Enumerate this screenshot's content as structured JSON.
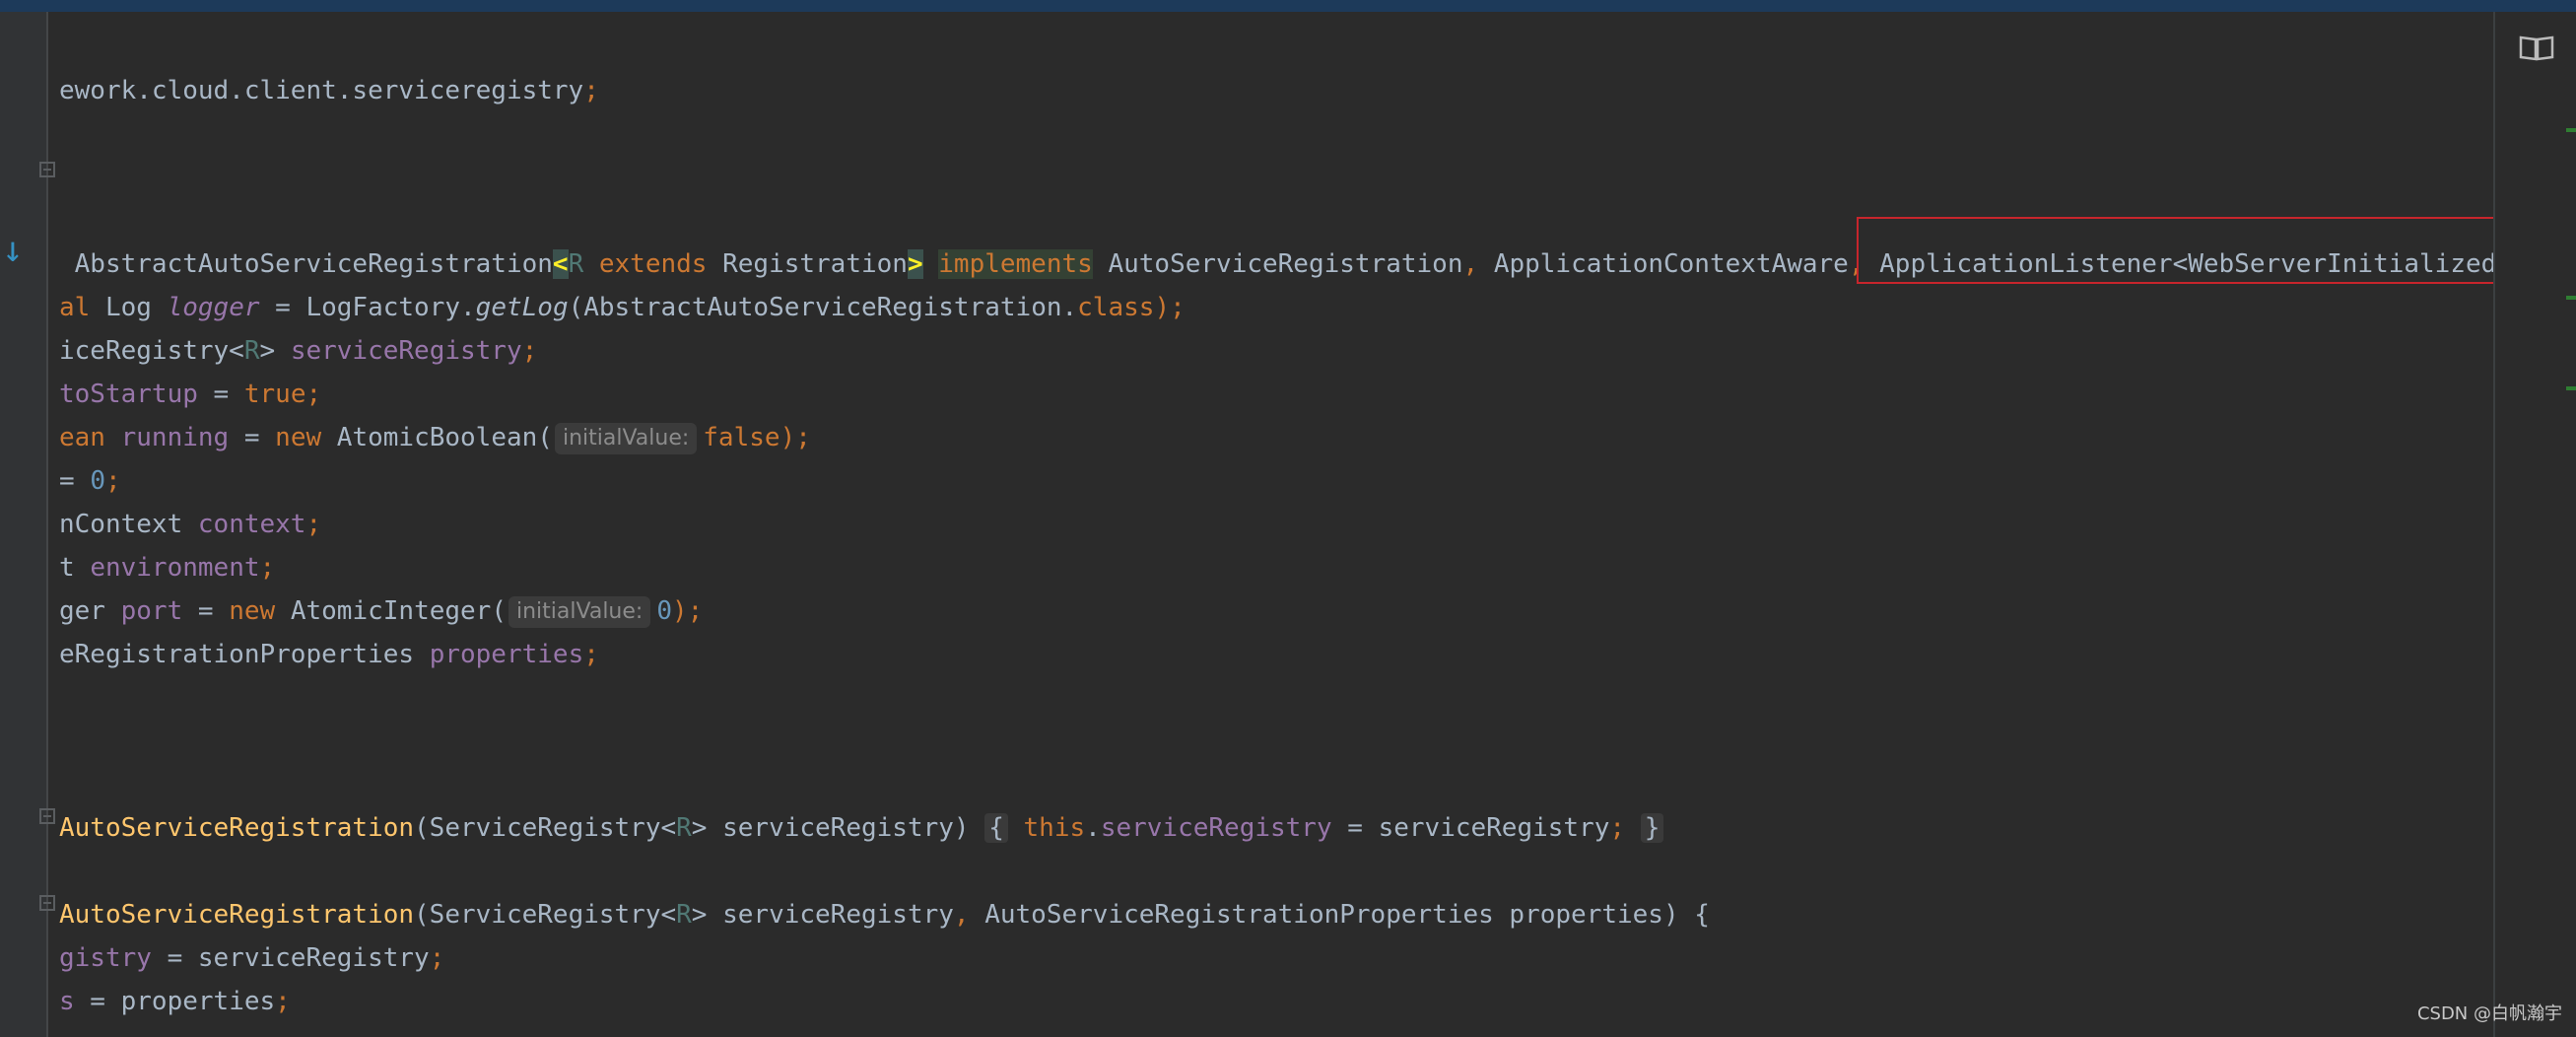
{
  "editor": {
    "lines": [
      {
        "id": "l1",
        "tokens": [
          {
            "t": "ework.cloud.client.serviceregistry",
            "c": ""
          },
          {
            "t": ";",
            "c": "kw"
          }
        ]
      },
      {
        "id": "l2",
        "tokens": [
          {
            "t": " AbstractAutoServiceRegistration",
            "c": ""
          },
          {
            "t": "<",
            "c": "bracket-hl"
          },
          {
            "t": "R",
            "c": "tp"
          },
          {
            "t": " extends ",
            "c": "kw"
          },
          {
            "t": "Registration",
            "c": ""
          },
          {
            "t": ">",
            "c": "bracket-hl"
          },
          {
            "t": " ",
            "c": ""
          },
          {
            "t": "implements",
            "c": "kw kw-hl"
          },
          {
            "t": " AutoServiceRegistration",
            "c": ""
          },
          {
            "t": ", ",
            "c": "kw"
          },
          {
            "t": "ApplicationContextAware",
            "c": ""
          },
          {
            "t": ", ",
            "c": "kw"
          },
          {
            "t": "ApplicationListener<WebServerInitializedEvent>",
            "c": ""
          }
        ]
      },
      {
        "id": "l3",
        "tokens": [
          {
            "t": "al ",
            "c": "kw"
          },
          {
            "t": "Log ",
            "c": ""
          },
          {
            "t": "logger",
            "c": "fld-i"
          },
          {
            "t": " = LogFactory.",
            "c": ""
          },
          {
            "t": "getLog",
            "c": "it"
          },
          {
            "t": "(AbstractAutoServiceRegistration.",
            "c": ""
          },
          {
            "t": "class",
            "c": "kw"
          },
          {
            "t": ");",
            "c": "kw"
          }
        ]
      },
      {
        "id": "l4",
        "tokens": [
          {
            "t": "iceRegistry<",
            "c": ""
          },
          {
            "t": "R",
            "c": "tp"
          },
          {
            "t": "> ",
            "c": ""
          },
          {
            "t": "serviceRegistry",
            "c": "fld"
          },
          {
            "t": ";",
            "c": "kw"
          }
        ]
      },
      {
        "id": "l5",
        "tokens": [
          {
            "t": "toStartup",
            "c": "fld"
          },
          {
            "t": " = ",
            "c": ""
          },
          {
            "t": "true;",
            "c": "kw"
          }
        ]
      },
      {
        "id": "l6",
        "tokens": [
          {
            "t": "ean ",
            "c": "kw"
          },
          {
            "t": "running",
            "c": "fld"
          },
          {
            "t": " = ",
            "c": ""
          },
          {
            "t": "new ",
            "c": "kw"
          },
          {
            "t": "AtomicBoolean(",
            "c": ""
          },
          {
            "t": "initialValue:",
            "c": "hint"
          },
          {
            "t": "false",
            "c": "kw"
          },
          {
            "t": ");",
            "c": "kw"
          }
        ]
      },
      {
        "id": "l7",
        "tokens": [
          {
            "t": "= ",
            "c": ""
          },
          {
            "t": "0",
            "c": "num"
          },
          {
            "t": ";",
            "c": "kw"
          }
        ]
      },
      {
        "id": "l8",
        "tokens": [
          {
            "t": "nContext ",
            "c": ""
          },
          {
            "t": "context",
            "c": "fld"
          },
          {
            "t": ";",
            "c": "kw"
          }
        ]
      },
      {
        "id": "l9",
        "tokens": [
          {
            "t": "t ",
            "c": ""
          },
          {
            "t": "environment",
            "c": "fld"
          },
          {
            "t": ";",
            "c": "kw"
          }
        ]
      },
      {
        "id": "l10",
        "tokens": [
          {
            "t": "ger ",
            "c": ""
          },
          {
            "t": "port",
            "c": "fld"
          },
          {
            "t": " = ",
            "c": ""
          },
          {
            "t": "new ",
            "c": "kw"
          },
          {
            "t": "AtomicInteger(",
            "c": ""
          },
          {
            "t": "initialValue:",
            "c": "hint"
          },
          {
            "t": "0",
            "c": "num"
          },
          {
            "t": ");",
            "c": "kw"
          }
        ]
      },
      {
        "id": "l11",
        "tokens": [
          {
            "t": "eRegistrationProperties ",
            "c": ""
          },
          {
            "t": "properties",
            "c": "fld"
          },
          {
            "t": ";",
            "c": "kw"
          }
        ]
      },
      {
        "id": "l12",
        "tokens": [
          {
            "t": "AutoServiceRegistration",
            "c": "fn"
          },
          {
            "t": "(ServiceRegistry<",
            "c": ""
          },
          {
            "t": "R",
            "c": "tp"
          },
          {
            "t": "> serviceRegistry) ",
            "c": ""
          },
          {
            "t": "{",
            "c": "brace-box"
          },
          {
            "t": " ",
            "c": ""
          },
          {
            "t": "this",
            "c": "kw"
          },
          {
            "t": ".",
            "c": ""
          },
          {
            "t": "serviceRegistry",
            "c": "fld"
          },
          {
            "t": " = serviceRegistry",
            "c": ""
          },
          {
            "t": ";",
            "c": "kw"
          },
          {
            "t": " ",
            "c": ""
          },
          {
            "t": "}",
            "c": "brace-box"
          }
        ]
      },
      {
        "id": "l13",
        "tokens": [
          {
            "t": "AutoServiceRegistration",
            "c": "fn"
          },
          {
            "t": "(ServiceRegistry<",
            "c": ""
          },
          {
            "t": "R",
            "c": "tp"
          },
          {
            "t": "> serviceRegistry",
            "c": ""
          },
          {
            "t": ", ",
            "c": "kw"
          },
          {
            "t": "AutoServiceRegistrationProperties properties) {",
            "c": ""
          }
        ]
      },
      {
        "id": "l14",
        "tokens": [
          {
            "t": "gistry",
            "c": "fld"
          },
          {
            "t": " = serviceRegistry",
            "c": ""
          },
          {
            "t": ";",
            "c": "kw"
          }
        ]
      },
      {
        "id": "l15",
        "tokens": [
          {
            "t": "s",
            "c": "fld"
          },
          {
            "t": " = properties",
            "c": ""
          },
          {
            "t": ";",
            "c": "kw"
          }
        ]
      }
    ]
  },
  "icons": {
    "reader_mode": "book-icon",
    "implement_marker": "down-arrow-icon"
  },
  "watermark": "CSDN @白帆瀚宇",
  "colors": {
    "background": "#2b2b2b",
    "keyword": "#cc7832",
    "field": "#9876aa",
    "method": "#ffc66d",
    "number": "#6897bb",
    "selection_box": "#c7252c"
  }
}
